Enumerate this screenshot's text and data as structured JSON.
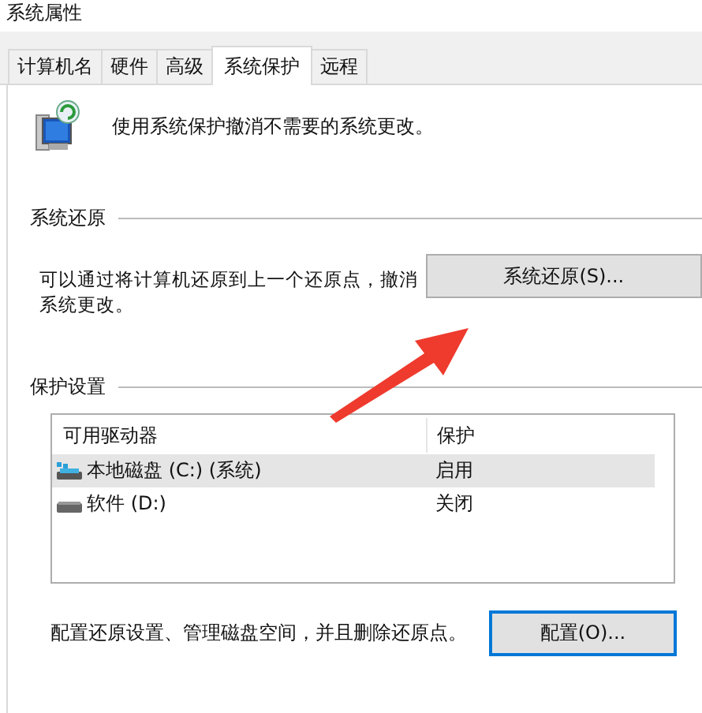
{
  "window": {
    "title": "系统属性"
  },
  "tabs": [
    {
      "label": "计算机名",
      "selected": false
    },
    {
      "label": "硬件",
      "selected": false
    },
    {
      "label": "高级",
      "selected": false
    },
    {
      "label": "系统保护",
      "selected": true
    },
    {
      "label": "远程",
      "selected": false
    }
  ],
  "intro": "使用系统保护撤消不需要的系统更改。",
  "restore": {
    "heading": "系统还原",
    "text": "可以通过将计算机还原到上一个还原点，撤消系统更改。",
    "button": "系统还原(S)..."
  },
  "protection": {
    "heading": "保护设置",
    "columns": [
      "可用驱动器",
      "保护"
    ],
    "rows": [
      {
        "kind": "system",
        "drive": "本地磁盘 (C:) (系统)",
        "status": "启用",
        "selected": true
      },
      {
        "kind": "drive",
        "drive": "软件 (D:)",
        "status": "关闭",
        "selected": false
      }
    ],
    "text": "配置还原设置、管理磁盘空间，并且删除还原点。",
    "button": "配置(O)..."
  }
}
